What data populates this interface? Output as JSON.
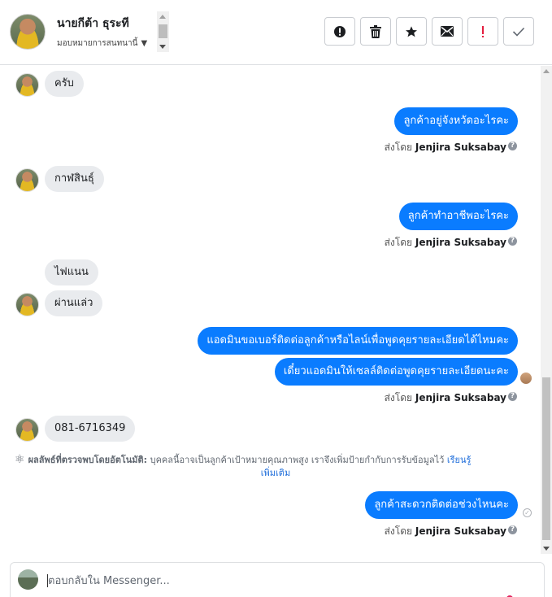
{
  "header": {
    "contact_name": "นายกีต้า ธุระที",
    "assign_label": "มอบหมายการสนทนานี้",
    "toolbar": [
      {
        "name": "alert-circle-icon"
      },
      {
        "name": "trash-icon"
      },
      {
        "name": "star-icon"
      },
      {
        "name": "envelope-icon"
      },
      {
        "name": "exclamation-icon"
      },
      {
        "name": "checkmark-icon"
      }
    ]
  },
  "messages": {
    "m1": "ครับ",
    "m2": "ลูกค้าอยู่จังหวัดอะไรคะ",
    "m3": "กาฬสินธุ์",
    "m4": "ลูกค้าทำอาชีพอะไรคะ",
    "m5": "ไฟแนน",
    "m6": "ผ่านแล่ว",
    "m7": "แอดมินขอเบอร์ติดต่อลูกค้าหรือไลน์เพื่อพูดคุยรายละเอียดได้ไหมคะ",
    "m8": "เดี๋ยวแอดมินให้เซลล์ติดต่อพูดคุยรายละเอียดนะคะ",
    "m9": "081-6716349",
    "m10": "ลูกค้าสะดวกติดต่อช่วงไหนคะ"
  },
  "sent_by": {
    "prefix": "ส่งโดย",
    "agent": "Jenjira Suksabay"
  },
  "ai_note": {
    "title": "ผลลัพธ์ที่ตรวจพบโดยอัตโนมัติ:",
    "body": "บุคคลนี้อาจเป็นลูกค้าเป้าหมายคุณภาพสูง เราจึงเพิ่มป้ายกำกับการรับข้อมูลไว้",
    "link1": "เรียนรู้",
    "link2": "เพิ่มเติม"
  },
  "composer": {
    "placeholder": "ตอบกลับใน Messenger..."
  },
  "colors": {
    "outgoing_bubble": "#0a7cff",
    "incoming_bubble": "#e9ebee",
    "link": "#216fdb",
    "danger": "#e41e3f"
  }
}
